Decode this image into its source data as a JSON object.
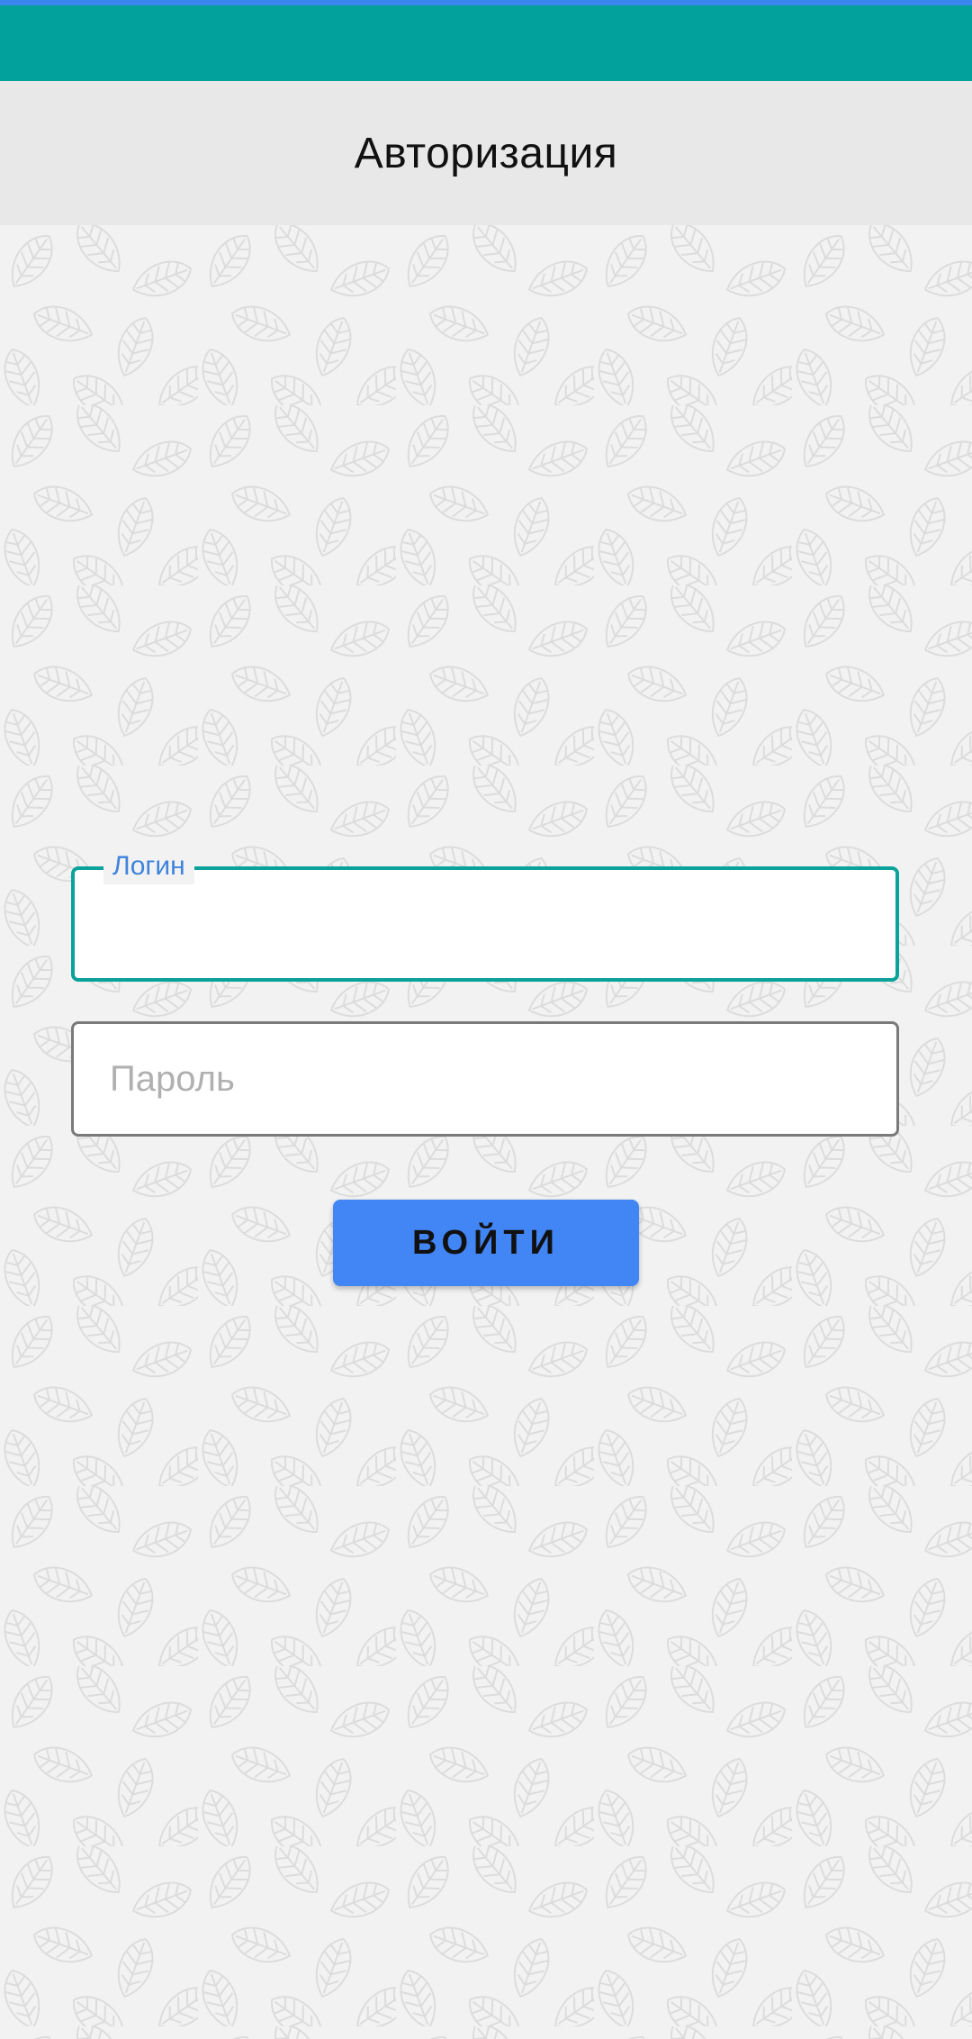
{
  "header": {
    "title": "Авторизация"
  },
  "form": {
    "login": {
      "label": "Логин",
      "value": "",
      "placeholder": ""
    },
    "password": {
      "label": "",
      "value": "",
      "placeholder": "Пароль"
    },
    "submit_label": "ВОЙТИ"
  },
  "colors": {
    "status_bar": "#02a19c",
    "accent_focus": "#0aa29a",
    "label_blue": "#3f83db",
    "button": "#4285f4",
    "background": "#f2f2f2",
    "title_bar": "#e8e8e8"
  }
}
